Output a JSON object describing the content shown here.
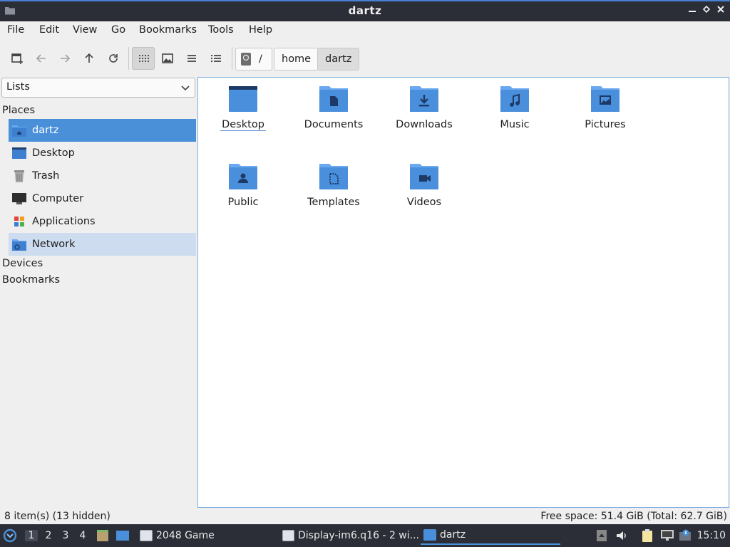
{
  "window": {
    "title": "dartz"
  },
  "menu": [
    "File",
    "Edit",
    "View",
    "Go",
    "Bookmarks",
    "Tools",
    "Help"
  ],
  "breadcrumbs": {
    "root": "/",
    "home": "home",
    "current": "dartz"
  },
  "sidebar": {
    "combo": "Lists",
    "places_label": "Places",
    "places": [
      {
        "label": "dartz",
        "icon": "home-folder-icon"
      },
      {
        "label": "Desktop",
        "icon": "desktop-folder-icon"
      },
      {
        "label": "Trash",
        "icon": "trash-icon"
      },
      {
        "label": "Computer",
        "icon": "computer-icon"
      },
      {
        "label": "Applications",
        "icon": "applications-icon"
      },
      {
        "label": "Network",
        "icon": "network-icon"
      }
    ],
    "devices_label": "Devices",
    "bookmarks_label": "Bookmarks"
  },
  "files": [
    {
      "label": "Desktop",
      "icon": "desktop-folder-icon"
    },
    {
      "label": "Documents",
      "icon": "documents-folder-icon"
    },
    {
      "label": "Downloads",
      "icon": "downloads-folder-icon"
    },
    {
      "label": "Music",
      "icon": "music-folder-icon"
    },
    {
      "label": "Pictures",
      "icon": "pictures-folder-icon"
    },
    {
      "label": "Public",
      "icon": "public-folder-icon"
    },
    {
      "label": "Templates",
      "icon": "templates-folder-icon"
    },
    {
      "label": "Videos",
      "icon": "videos-folder-icon"
    }
  ],
  "status": {
    "left": "8 item(s) (13 hidden)",
    "right": "Free space: 51.4 GiB (Total: 62.7 GiB)"
  },
  "taskbar": {
    "workspaces": [
      "1",
      "2",
      "3",
      "4"
    ],
    "tasks": [
      "2048 Game",
      "Display-im6.q16 - 2 wi...",
      "dartz"
    ],
    "clock": "15:10"
  },
  "colors": {
    "accent": "#4a90d9",
    "folder": "#4a8fdc",
    "folder_dark": "#2c5a9a",
    "panel": "#2b2e37"
  }
}
